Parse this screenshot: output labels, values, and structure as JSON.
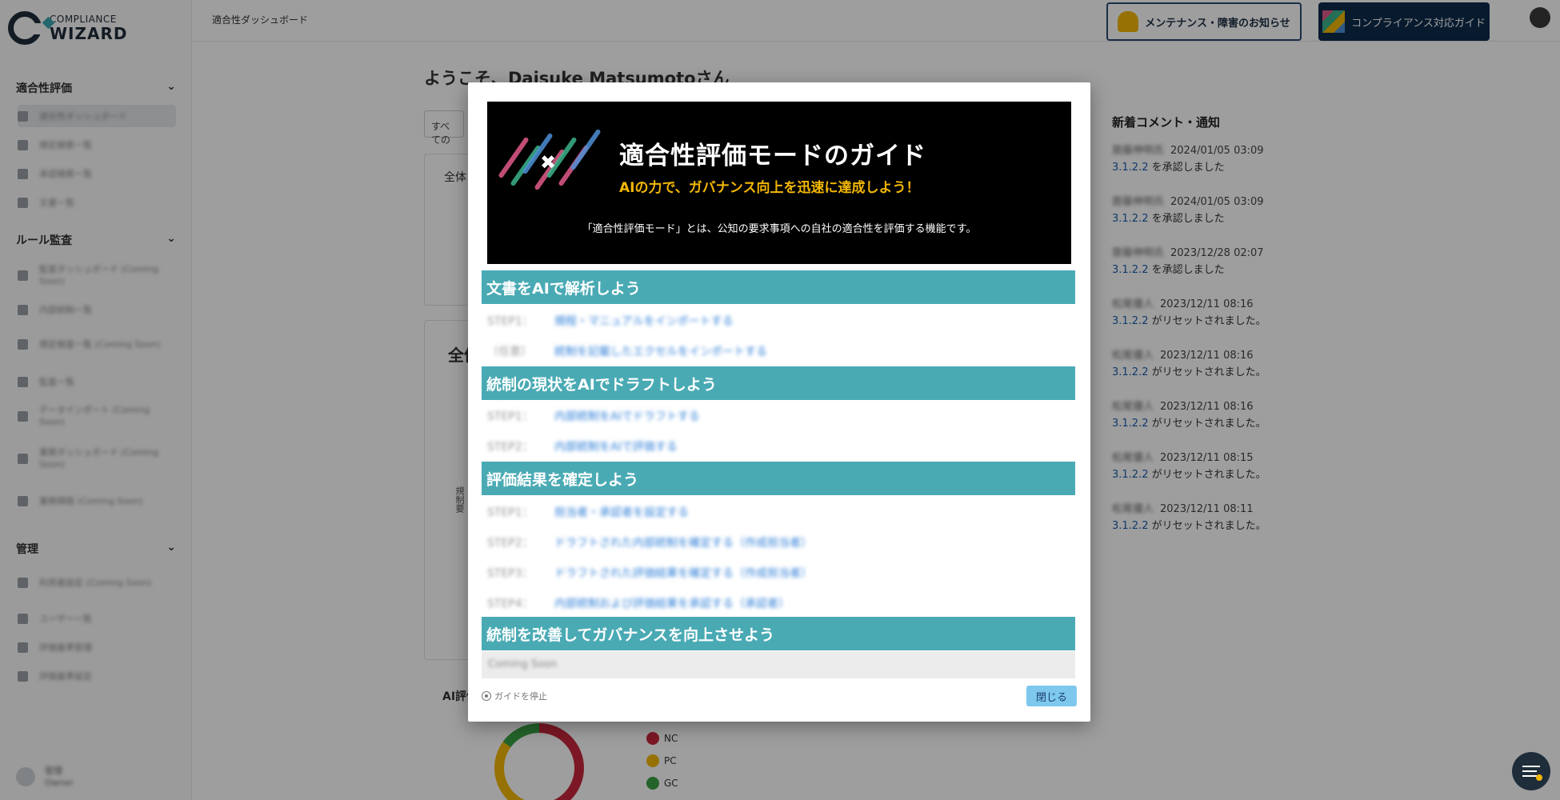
{
  "app": {
    "logo_line1": "COMPLIANCE",
    "logo_line2": "WIZARD",
    "breadcrumb": "適合性ダッシュボード",
    "maintenance_button": "メンテナンス・障害のお知らせ",
    "guide_button": "コンプライアンス対応ガイド"
  },
  "sidebar": {
    "sections": [
      {
        "label": "適合性評価",
        "items": [
          "適合性ダッシュボード",
          "規定検索一覧",
          "承認検索一覧",
          "文書一覧"
        ]
      },
      {
        "label": "ルール監査",
        "items": [
          "監査ダッシュボード (Coming Soon)",
          "内部統制一覧",
          "規定検査一覧 (Coming Soon)",
          "監査一覧",
          "データインポート (Coming Soon)",
          "業務ダッシュボード (Coming Soon)",
          "業務規程 (Coming Soon)"
        ]
      },
      {
        "label": "管理",
        "items": [
          "利用者設定 (Coming Soon)",
          "ユーザー一覧",
          "評価基準管理",
          "評価基準設定"
        ]
      }
    ],
    "user": {
      "name": "管理",
      "sub": "Owner"
    }
  },
  "main": {
    "welcome": "ようこそ、Daisuke Matsumotoさん",
    "filter_value": "すべての",
    "card1_title": "全体",
    "card2_title": "全体",
    "vertical_label": "規制要",
    "ai_title": "AI評価",
    "legend": [
      {
        "label": "NC",
        "color": "#c8283d"
      },
      {
        "label": "PC",
        "color": "#f2b705"
      },
      {
        "label": "GC",
        "color": "#3aa245"
      }
    ]
  },
  "notifications": {
    "title": "新着コメント・通知",
    "items": [
      {
        "who": "齋藤伸明氏",
        "time": "2024/01/05 03:09",
        "control": "3.1.2.2",
        "action": "を承認しました"
      },
      {
        "who": "齋藤伸明氏",
        "time": "2024/01/05 03:09",
        "control": "3.1.2.2",
        "action": "を承認しました"
      },
      {
        "who": "齋藤伸明氏",
        "time": "2023/12/28 02:07",
        "control": "3.1.2.2",
        "action": "を承認しました"
      },
      {
        "who": "松尾優人",
        "time": "2023/12/11 08:16",
        "control": "3.1.2.2",
        "action": "がリセットされました。"
      },
      {
        "who": "松尾優人",
        "time": "2023/12/11 08:16",
        "control": "3.1.2.2",
        "action": "がリセットされました。"
      },
      {
        "who": "松尾優人",
        "time": "2023/12/11 08:16",
        "control": "3.1.2.2",
        "action": "がリセットされました。"
      },
      {
        "who": "松尾優人",
        "time": "2023/12/11 08:15",
        "control": "3.1.2.2",
        "action": "がリセットされました。"
      },
      {
        "who": "松尾優人",
        "time": "2023/12/11 08:11",
        "control": "3.1.2.2",
        "action": "がリセットされました。"
      }
    ]
  },
  "modal": {
    "banner_title": "適合性評価モードのガイド",
    "banner_subtitle": "AIの力で、ガバナンス向上を迅速に達成しよう！",
    "banner_description": "「適合性評価モード」とは、公知の要求事項への自社の適合性を評価する機能です。",
    "sections": [
      {
        "title": "文書をAIで解析しよう",
        "steps": [
          {
            "label": "STEP1：",
            "action": "規程・マニュアルをインポートする"
          },
          {
            "label": "（任意）",
            "action": "統制を記載したエクセルをインポートする"
          }
        ]
      },
      {
        "title": "統制の現状をAIでドラフトしよう",
        "steps": [
          {
            "label": "STEP1：",
            "action": "内部統制をAIでドラフトする"
          },
          {
            "label": "STEP2：",
            "action": "内部統制をAIで評価する"
          }
        ]
      },
      {
        "title": "評価結果を確定しよう",
        "steps": [
          {
            "label": "STEP1：",
            "action": "担当者・承認者を設定する"
          },
          {
            "label": "STEP2：",
            "action": "ドラフトされた内部統制を確定する（作成担当者）"
          },
          {
            "label": "STEP3：",
            "action": "ドラフトされた評価結果を確定する（作成担当者）"
          },
          {
            "label": "STEP4：",
            "action": "内部統制および評価結果を承認する（承認者）"
          }
        ]
      },
      {
        "title": "統制を改善してガバナンスを向上させよう",
        "steps": []
      }
    ],
    "coming_soon": "Coming Soon",
    "hide_guide_label": "ガイドを停止",
    "close_button": "閉じる"
  }
}
